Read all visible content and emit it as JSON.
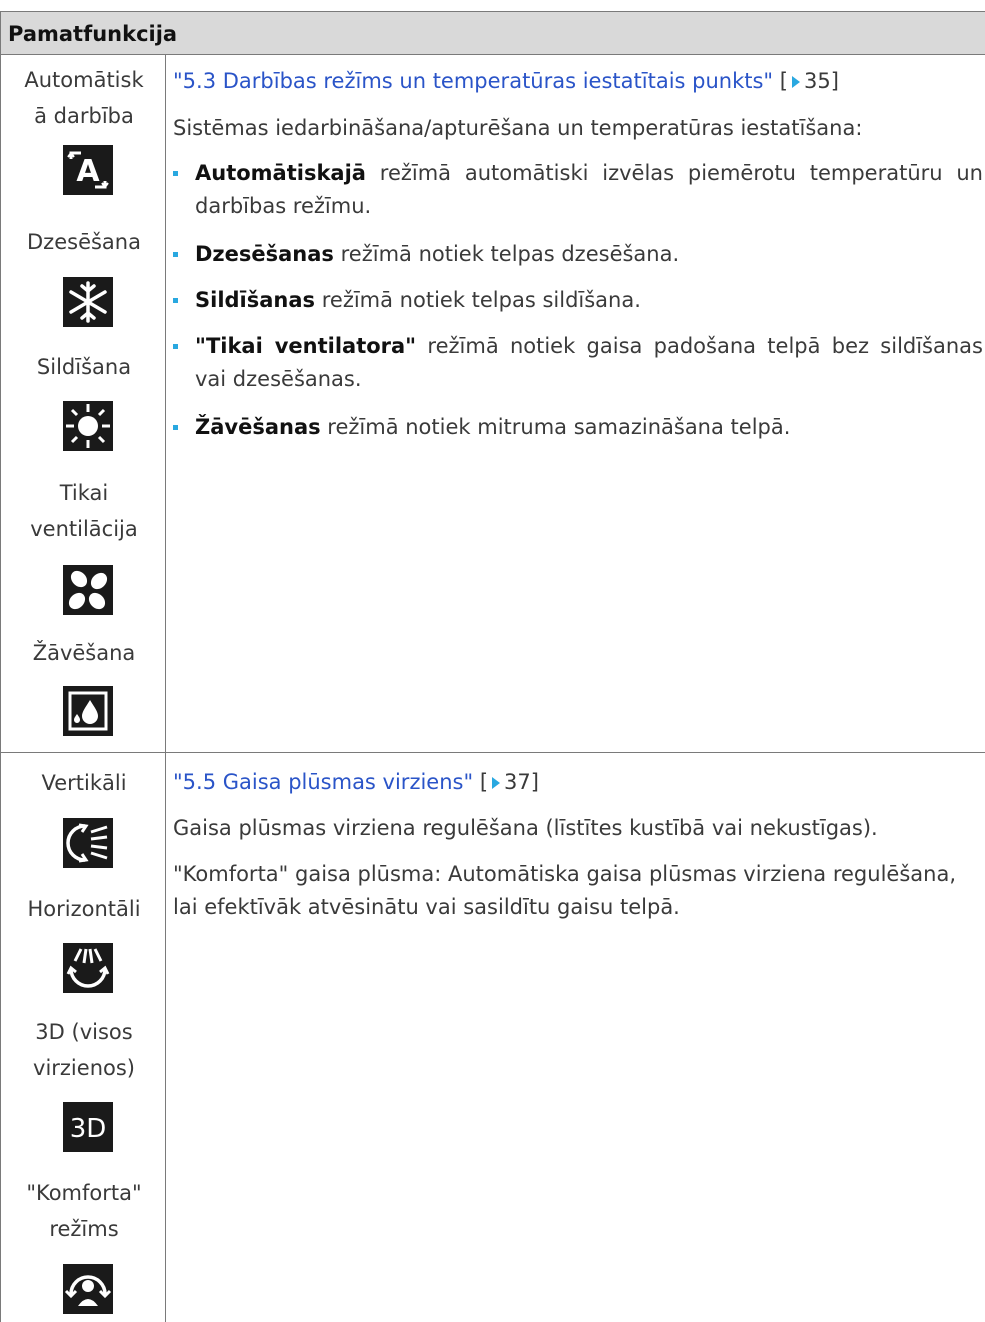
{
  "header": {
    "title": "Pamatfunkcija"
  },
  "row1": {
    "labels": [
      "Automātisk\nā darbība",
      "Dzesēšana",
      "Sildīšana",
      "Tikai\nventilācija",
      "Žāvēšana"
    ],
    "icons": [
      "auto-mode-icon",
      "snowflake-icon",
      "sun-icon",
      "fan-icon",
      "drop-icon"
    ],
    "link": "\"5.3 Darbības režīms un temperatūras iestatītais punkts\"",
    "link_bracket_open": "[",
    "page_ref": "35]",
    "intro": "Sistēmas iedarbināšana/apturēšana un temperatūras iestatīšana:",
    "bullets": [
      {
        "bold": "Automātiskajā",
        "text": " režīmā automātiski izvēlas piemērotu temperatūru un darbības režīmu."
      },
      {
        "bold": "Dzesēšanas",
        "text": " režīmā notiek telpas dzesēšana."
      },
      {
        "bold": "Sildīšanas",
        "text": " režīmā notiek telpas sildīšana."
      },
      {
        "bold": "\"Tikai ventilatora\"",
        "text": " režīmā notiek gaisa padošana telpā bez sildīšanas vai dzesēšanas."
      },
      {
        "bold": "Žāvēšanas",
        "text": " režīmā notiek mitruma samazināšana telpā."
      }
    ]
  },
  "row2": {
    "labels": [
      "Vertikāli",
      "Horizontāli",
      "3D (visos\nvirzienos)",
      "\"Komforta\"\nrežīms"
    ],
    "icons": [
      "vertical-swing-icon",
      "horizontal-swing-icon",
      "3d-icon",
      "comfort-mode-icon"
    ],
    "icon_3d_text": "3D",
    "link": "\"5.5 Gaisa plūsmas virziens\"",
    "link_bracket_open": "[",
    "page_ref": "37]",
    "para1": "Gaisa plūsmas virziena regulēšana (līstītes kustībā vai nekustīgas).",
    "para2": "\"Komforta\" gaisa plūsma: Automātiska gaisa plūsmas virziena regulēšana, lai efektīvāk atvēsinātu vai sasildītu gaisu telpā."
  },
  "colors": {
    "link": "#2a54c8",
    "accent": "#29a8e0",
    "header_bg": "#d9d9d9"
  }
}
